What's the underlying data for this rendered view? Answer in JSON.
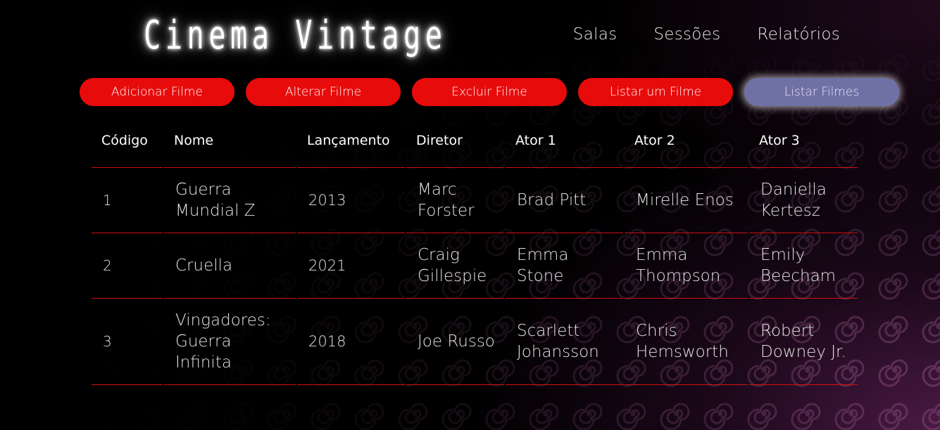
{
  "brand": {
    "title": "Cinema Vintage"
  },
  "nav": {
    "items": [
      {
        "label": "Salas"
      },
      {
        "label": "Sessões"
      },
      {
        "label": "Relatórios"
      }
    ]
  },
  "actions": {
    "add_label": "Adicionar Filme",
    "edit_label": "Alterar Filme",
    "delete_label": "Excluir Filme",
    "list_one_label": "Listar um Filme",
    "list_all_label": "Listar Filmes",
    "active": "Listar Filmes"
  },
  "table": {
    "columns": [
      "Código",
      "Nome",
      "Lançamento",
      "Diretor",
      "Ator 1",
      "Ator 2",
      "Ator 3"
    ],
    "rows": [
      [
        "1",
        "Guerra Mundial Z",
        "2013",
        "Marc Forster",
        "Brad Pitt",
        "Mirelle Enos",
        "Daniella Kertesz"
      ],
      [
        "2",
        "Cruella",
        "2021",
        "Craig Gillespie",
        "Emma Stone",
        "Emma Thompson",
        "Emily Beecham"
      ],
      [
        "3",
        "Vingadores: Guerra Infinita",
        "2018",
        "Joe Russo",
        "Scarlett Johansson",
        "Chris Hemsworth",
        "Robert Downey Jr."
      ]
    ]
  },
  "colors": {
    "accent_red": "#e80b0b",
    "active_button": "#6f71a6",
    "row_divider": "#d21010"
  }
}
